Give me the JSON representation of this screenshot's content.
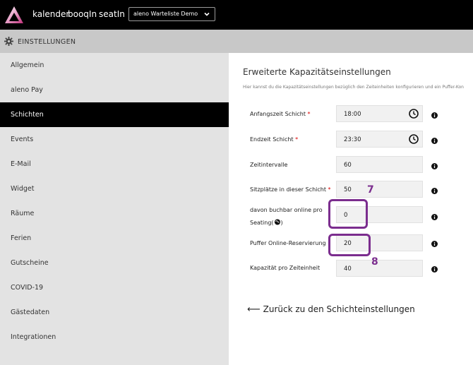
{
  "topbar": {
    "nav": [
      "kalender",
      "booqIn",
      "seatIn"
    ],
    "location_select": "aleno Warteliste Demo"
  },
  "settings_bar": {
    "title": "EINSTELLUNGEN"
  },
  "sidebar": {
    "items": [
      {
        "label": "Allgemein"
      },
      {
        "label": "aleno Pay"
      },
      {
        "label": "Schichten"
      },
      {
        "label": "Events"
      },
      {
        "label": "E-Mail"
      },
      {
        "label": "Widget"
      },
      {
        "label": "Räume"
      },
      {
        "label": "Ferien"
      },
      {
        "label": "Gutscheine"
      },
      {
        "label": "COVID-19"
      },
      {
        "label": "Gästedaten"
      },
      {
        "label": "Integrationen"
      }
    ],
    "active": "Schichten"
  },
  "main": {
    "heading": "Erweiterte Kapazitätseinstellungen",
    "subtext": "Hier kannst du die Kapazitätseinstellungen bezüglich den Zeiteinheiten konfigurieren und ein Puffer-Kon",
    "fields": [
      {
        "label": "Anfangszeit Schicht",
        "required": "*",
        "value": "18:00"
      },
      {
        "label": "Endzeit Schicht",
        "required": "*",
        "value": "23:30"
      },
      {
        "label": "Zeitintervalle",
        "value": "60"
      },
      {
        "label": "Sitzplätze in dieser Schicht",
        "required": "*",
        "value": "50"
      },
      {
        "label_line1": "davon buchbar online pro",
        "label_line2": "Seating",
        "value": "0"
      },
      {
        "label": "Puffer Online-Reservierung",
        "value": "20"
      },
      {
        "label": "Kapazität pro Zeiteinheit",
        "value": "40"
      }
    ],
    "back_link": "Zurück zu den Schichteinstellungen"
  },
  "annotations": {
    "marker_7": "7",
    "marker_8": "8"
  },
  "colors": {
    "accent": "#7b2d8e",
    "topbar": "#000000",
    "sidebar": "#e3e3e3",
    "required": "#dd0000"
  }
}
